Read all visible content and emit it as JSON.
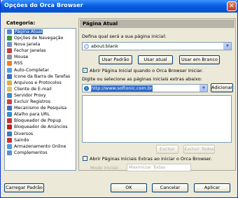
{
  "window": {
    "title": "Opções do Orca Browser",
    "close_glyph": "✕"
  },
  "sidebar": {
    "label": "Categoria:",
    "items": [
      {
        "label": "Página Atual",
        "icon": "page-icon",
        "color": "#4a86d8",
        "selected": true
      },
      {
        "label": "Opções de Navegação",
        "icon": "navigation-icon",
        "color": "#3a9a3a"
      },
      {
        "label": "Nova Janela",
        "icon": "new-window-icon",
        "color": "#6f8fc8"
      },
      {
        "label": "Fechar Janelas",
        "icon": "close-windows-icon",
        "color": "#c84040"
      },
      {
        "label": "Mouse",
        "icon": "mouse-icon",
        "color": "#909090"
      },
      {
        "label": "RSS",
        "icon": "rss-icon",
        "color": "#f08020"
      },
      {
        "label": "Auto-Completar",
        "icon": "autocomplete-icon",
        "color": "#5aa0e0"
      },
      {
        "label": "Ícone da Barra de Tarefas",
        "icon": "taskbar-icon",
        "color": "#3c6cc8"
      },
      {
        "label": "Arquivos e Protocolos",
        "icon": "files-icon",
        "color": "#d8b040"
      },
      {
        "label": "Cliente de E-mail",
        "icon": "email-icon",
        "color": "#e0c060"
      },
      {
        "label": "Servidor Proxy",
        "icon": "proxy-icon",
        "color": "#3a8ad0"
      },
      {
        "label": "Excluir Registros",
        "icon": "delete-records-icon",
        "color": "#d04040"
      },
      {
        "label": "Mecanismo de Pesquisa",
        "icon": "search-engine-icon",
        "color": "#4070c0"
      },
      {
        "label": "Atalho para URL",
        "icon": "url-shortcut-icon",
        "color": "#3090d0"
      },
      {
        "label": "Bloqueador de Popup",
        "icon": "popup-blocker-icon",
        "color": "#d03030"
      },
      {
        "label": "Bloqueador de Anúncios",
        "icon": "ad-blocker-icon",
        "color": "#c02020"
      },
      {
        "label": "Diversos",
        "icon": "misc-icon",
        "color": "#3a7ac0"
      },
      {
        "label": "Saindo",
        "icon": "exit-icon",
        "color": "#d03030"
      },
      {
        "label": "Armazenamento Online",
        "icon": "online-storage-icon",
        "color": "#40a0e0"
      },
      {
        "label": "Complementos",
        "icon": "addons-icon",
        "color": "#5a90d0"
      }
    ]
  },
  "panel": {
    "header": "Página Atual",
    "homepage_label": "Defina qual será a sua página inicial:",
    "homepage_value": "about:blank",
    "btn_default": "Usar Padrão",
    "btn_current": "Usar atual",
    "btn_blank": "Usar em Branco",
    "open_on_start_label": "Abrir Página Inicial quando o Orca Browser  Iniciar.",
    "extra_label": "Digite ou selecione as páginas iniciais extras abaixo:",
    "extra_value": "http://www.softonic.com.br",
    "btn_add": "Adicionar",
    "btn_delete": "Excluir",
    "btn_delete_all": "Excluir Todos",
    "open_extra_label": "Abrir Páginas Iniciais Extras ao iniciar o Orca Browser.",
    "start_mode_label": "Modo Inicial:",
    "start_mode_value": "Maximizar Todas",
    "check_glyph": "✓",
    "arrow_glyph": "▼"
  },
  "footer": {
    "btn_load_default": "Carregar Padrão",
    "btn_ok": "OK",
    "btn_cancel": "Cancelar",
    "btn_apply": "Aplicar"
  }
}
